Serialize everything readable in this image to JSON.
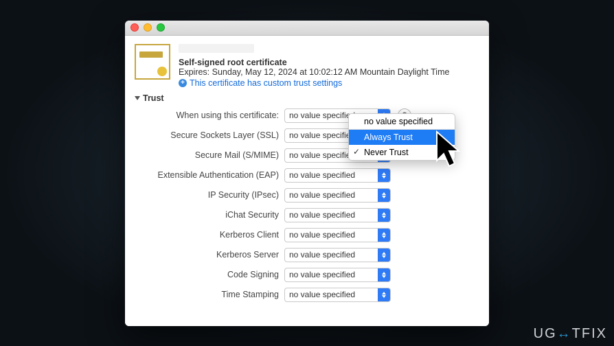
{
  "watermark_prefix": "UG",
  "watermark_mid": "↔",
  "watermark_suffix": "TFIX",
  "header": {
    "subtitle": "Self-signed root certificate",
    "expires": "Expires: Sunday, May 12, 2024 at 10:02:12 AM Mountain Daylight Time",
    "custom_trust": "This certificate has custom trust settings"
  },
  "trust_label": "Trust",
  "rows": [
    {
      "label": "When using this certificate:",
      "value": "no value specified",
      "help": true
    },
    {
      "label": "Secure Sockets Layer (SSL)",
      "value": "no value specified"
    },
    {
      "label": "Secure Mail (S/MIME)",
      "value": "no value specified"
    },
    {
      "label": "Extensible Authentication (EAP)",
      "value": "no value specified"
    },
    {
      "label": "IP Security (IPsec)",
      "value": "no value specified"
    },
    {
      "label": "iChat Security",
      "value": "no value specified"
    },
    {
      "label": "Kerberos Client",
      "value": "no value specified"
    },
    {
      "label": "Kerberos Server",
      "value": "no value specified"
    },
    {
      "label": "Code Signing",
      "value": "no value specified"
    },
    {
      "label": "Time Stamping",
      "value": "no value specified"
    }
  ],
  "dropdown": {
    "items": [
      "no value specified",
      "Always Trust",
      "Never Trust"
    ],
    "highlighted_index": 1,
    "checked_index": 2
  }
}
